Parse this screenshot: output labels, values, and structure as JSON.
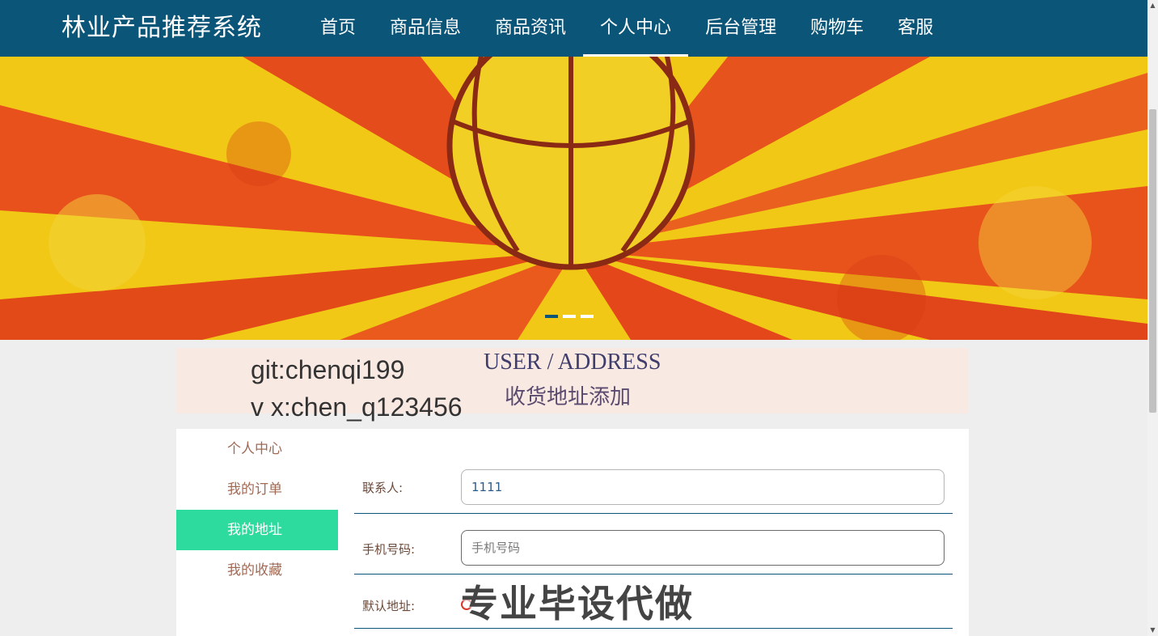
{
  "header": {
    "brand": "林业产品推荐系统",
    "nav": [
      {
        "label": "首页"
      },
      {
        "label": "商品信息"
      },
      {
        "label": "商品资讯"
      },
      {
        "label": "个人中心",
        "active": true
      },
      {
        "label": "后台管理"
      },
      {
        "label": "购物车"
      },
      {
        "label": "客服"
      }
    ]
  },
  "banner": {
    "slide_count": 3,
    "active_slide": 1
  },
  "title_block": {
    "watermark_line1": "git:chenqi199",
    "watermark_line2": "v x:chen_q123456",
    "title_en": "USER / ADDRESS",
    "title_cn": "收货地址添加"
  },
  "sidebar": {
    "items": [
      {
        "label": "个人中心"
      },
      {
        "label": "我的订单"
      },
      {
        "label": "我的地址",
        "active": true
      },
      {
        "label": "我的收藏"
      }
    ]
  },
  "form": {
    "contact": {
      "label": "联系人:",
      "value": "1111"
    },
    "phone": {
      "label": "手机号码:",
      "placeholder": "手机号码",
      "value": ""
    },
    "default_address": {
      "label": "默认地址:"
    }
  },
  "overlay": {
    "promo": "专业毕设代做"
  },
  "colors": {
    "nav_bg": "#0b5678",
    "accent_green": "#2edb9e",
    "title_bg": "#f8e9e2"
  }
}
